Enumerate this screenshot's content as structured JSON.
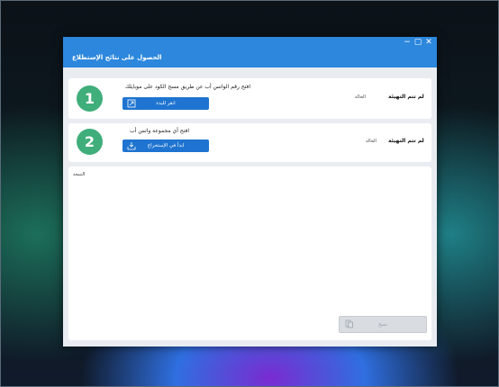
{
  "window": {
    "title": "الحصول على نتائج الإستطلاع",
    "controls": [
      "✕",
      "▢",
      "−"
    ]
  },
  "step1": {
    "number": "1",
    "instruction": "افتح رقم الواتس أب عن طريق مسح الكود على موبايلك",
    "button_label": "انقر للبدء",
    "status_label": "الحالة",
    "status_value": "لم تتم التهيئة",
    "button_icon": "open-external-icon"
  },
  "step2": {
    "number": "2",
    "instruction": "افتح أي مجموعة واتس أب",
    "button_label": "ابدأ في الإستخراج",
    "status_label": "الحالة",
    "status_value": "لم تتم التهيئة",
    "button_icon": "download-icon"
  },
  "result": {
    "label": "النتيجة",
    "copy_button_label": "نسخ",
    "copy_icon": "copy-icon"
  },
  "colors": {
    "accent": "#2c87dd",
    "button": "#1e74d0",
    "badge": "#3fae7a"
  }
}
